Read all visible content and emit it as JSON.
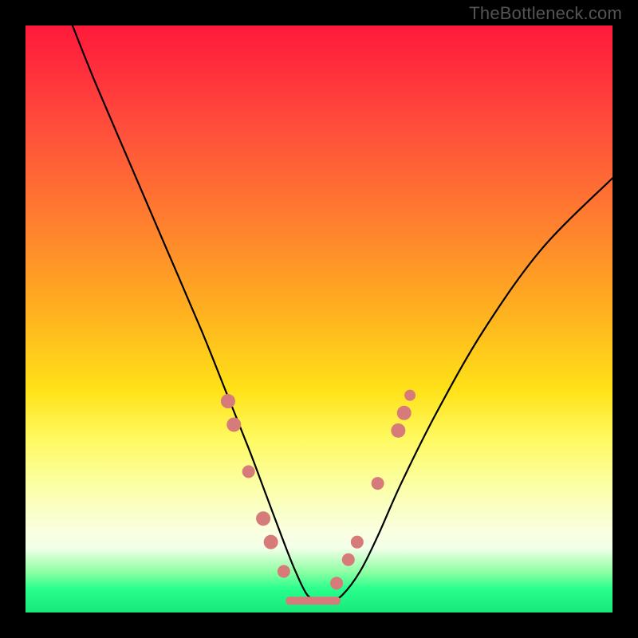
{
  "watermark": "TheBottleneck.com",
  "chart_data": {
    "type": "line",
    "title": "",
    "xlabel": "",
    "ylabel": "",
    "xlim": [
      0,
      100
    ],
    "ylim": [
      0,
      100
    ],
    "grid": false,
    "legend": false,
    "series": [
      {
        "name": "bottleneck-curve",
        "x": [
          8,
          12,
          18,
          24,
          30,
          34,
          38,
          41,
          44,
          46,
          48,
          50,
          52,
          54,
          57,
          60,
          64,
          70,
          78,
          88,
          100
        ],
        "y": [
          100,
          90,
          76,
          62,
          48,
          38,
          28,
          20,
          12,
          7,
          3,
          2,
          2,
          3,
          7,
          13,
          22,
          34,
          48,
          62,
          74
        ]
      }
    ],
    "markers": [
      {
        "series": "bottleneck-curve",
        "x": 34.5,
        "y": 36,
        "r": 9
      },
      {
        "series": "bottleneck-curve",
        "x": 35.5,
        "y": 32,
        "r": 9
      },
      {
        "series": "bottleneck-curve",
        "x": 38.0,
        "y": 24,
        "r": 8
      },
      {
        "series": "bottleneck-curve",
        "x": 40.5,
        "y": 16,
        "r": 9
      },
      {
        "series": "bottleneck-curve",
        "x": 41.8,
        "y": 12,
        "r": 9
      },
      {
        "series": "bottleneck-curve",
        "x": 44.0,
        "y": 7,
        "r": 8
      },
      {
        "series": "bottleneck-curve",
        "x": 53.0,
        "y": 5,
        "r": 8
      },
      {
        "series": "bottleneck-curve",
        "x": 55.0,
        "y": 9,
        "r": 8
      },
      {
        "series": "bottleneck-curve",
        "x": 56.5,
        "y": 12,
        "r": 8
      },
      {
        "series": "bottleneck-curve",
        "x": 60.0,
        "y": 22,
        "r": 8
      },
      {
        "series": "bottleneck-curve",
        "x": 63.5,
        "y": 31,
        "r": 9
      },
      {
        "series": "bottleneck-curve",
        "x": 64.5,
        "y": 34,
        "r": 9
      },
      {
        "series": "bottleneck-curve",
        "x": 65.5,
        "y": 37,
        "r": 7
      }
    ],
    "flat_minimum": {
      "x_start": 45,
      "x_end": 53,
      "y": 2
    },
    "background_gradient": {
      "top": "#ff1a3c",
      "mid": "#ffe117",
      "bottom": "#18e87a"
    }
  }
}
